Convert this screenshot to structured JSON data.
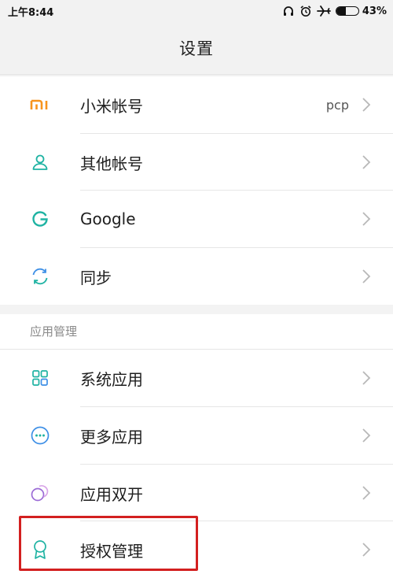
{
  "status_bar": {
    "time": "上午8:44",
    "battery_percent": "43%",
    "battery_level": 0.43,
    "icons": [
      "headphones-icon",
      "alarm-icon",
      "airplane-icon",
      "battery-icon"
    ]
  },
  "header": {
    "title": "设置"
  },
  "accounts": {
    "items": [
      {
        "label": "小米帐号",
        "value": "pcp",
        "icon": "mi-logo-icon"
      },
      {
        "label": "其他帐号",
        "icon": "person-icon"
      },
      {
        "label": "Google",
        "icon": "google-icon"
      },
      {
        "label": "同步",
        "icon": "sync-icon"
      }
    ]
  },
  "app_management": {
    "section_label": "应用管理",
    "items": [
      {
        "label": "系统应用",
        "icon": "grid-icon"
      },
      {
        "label": "更多应用",
        "icon": "more-icon"
      },
      {
        "label": "应用双开",
        "icon": "dual-apps-icon"
      },
      {
        "label": "授权管理",
        "icon": "badge-icon"
      }
    ]
  },
  "colors": {
    "mi_orange": "#f7941d",
    "icon_teal": "#1fb3a3",
    "icon_blue": "#3d8fe6",
    "icon_purple": "#9b6bd6",
    "highlight_red": "#d32020"
  }
}
